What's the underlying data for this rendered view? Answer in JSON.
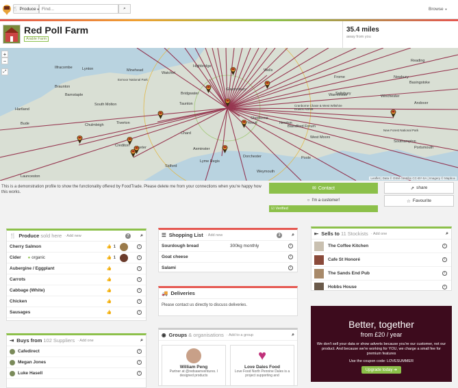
{
  "topbar": {
    "produce_label": "Produce",
    "search_placeholder": "Find...",
    "browse_label": "Browse"
  },
  "header": {
    "title": "Red Poll Farm",
    "badge": "Arable Farm",
    "distance": "35.4 miles",
    "distance_sub": "away from you"
  },
  "map": {
    "places": [
      {
        "name": "Ilfracombe"
      },
      {
        "name": "Lynton"
      },
      {
        "name": "Minehead"
      },
      {
        "name": "Watchet"
      },
      {
        "name": "Bridgwater"
      },
      {
        "name": "Glastonbury"
      },
      {
        "name": "Wells"
      },
      {
        "name": "Frome"
      },
      {
        "name": "Warminster"
      },
      {
        "name": "Basingstoke"
      },
      {
        "name": "Reading"
      },
      {
        "name": "Newbury"
      },
      {
        "name": "Andover"
      },
      {
        "name": "Salisbury"
      },
      {
        "name": "Winchester"
      },
      {
        "name": "Braunton"
      },
      {
        "name": "Barnstaple"
      },
      {
        "name": "South Molton"
      },
      {
        "name": "Taunton"
      },
      {
        "name": "Chard"
      },
      {
        "name": "Yeovil"
      },
      {
        "name": "Sherborne"
      },
      {
        "name": "Blandford Forum"
      },
      {
        "name": "Hartland"
      },
      {
        "name": "Chulmleigh"
      },
      {
        "name": "Tiverton"
      },
      {
        "name": "Crediton"
      },
      {
        "name": "Exeter"
      },
      {
        "name": "Axminster"
      },
      {
        "name": "Dorchester"
      },
      {
        "name": "Weymouth"
      },
      {
        "name": "Poole"
      },
      {
        "name": "Southampton"
      },
      {
        "name": "Portsmouth"
      },
      {
        "name": "Bude"
      },
      {
        "name": "Launceston"
      },
      {
        "name": "Sidford"
      },
      {
        "name": "Lyme Regis"
      },
      {
        "name": "West Moors"
      },
      {
        "name": "Newton"
      },
      {
        "name": "Exmoor National Park"
      },
      {
        "name": "New Forest National Park"
      },
      {
        "name": "Cranborne Chase & West Wiltshire Downs AONB"
      },
      {
        "name": "Highbridge"
      }
    ],
    "attribution": "Leaflet | Data © OSM contribs CC-BY-SA | Imagery © Mapbox"
  },
  "profile": {
    "description": "This is a demonstration profile to show the functionality offered by FoodTrade. Please delete me from your connections when you're happy how this works.",
    "contact": "Contact",
    "customer": "I'm a customer!",
    "verified": "Verified",
    "share": "share",
    "favourite": "Favourite"
  },
  "produce": {
    "title": "Produce",
    "sub": "sold here",
    "add": "· Add new",
    "count": "7",
    "items": [
      {
        "name": "Cherry Salmon",
        "likes": "1",
        "tag": ""
      },
      {
        "name": "Cider",
        "likes": "1",
        "tag": "organic"
      },
      {
        "name": "Aubergine / Eggplant",
        "likes": "",
        "tag": ""
      },
      {
        "name": "Carrots",
        "likes": "",
        "tag": ""
      },
      {
        "name": "Cabbage (White)",
        "likes": "",
        "tag": ""
      },
      {
        "name": "Chicken",
        "likes": "",
        "tag": ""
      },
      {
        "name": "Sausages",
        "likes": "",
        "tag": ""
      }
    ]
  },
  "shopping": {
    "title": "Shopping List",
    "add": "· Add new",
    "count": "3",
    "items": [
      {
        "name": "Sourdough bread",
        "qty": "300kg monthly"
      },
      {
        "name": "Goat cheese",
        "qty": ""
      },
      {
        "name": "Salami",
        "qty": ""
      }
    ]
  },
  "deliveries": {
    "title": "Deliveries",
    "text": "Please contact us directly to discuss deliveries."
  },
  "sells": {
    "title": "Sells to",
    "count": "11",
    "sub": "Stockists",
    "add": "· Add one",
    "items": [
      {
        "name": "The Coffee Kitchen"
      },
      {
        "name": "Cafe St Honoré"
      },
      {
        "name": "The Sands End Pub"
      },
      {
        "name": "Hobbs House"
      }
    ]
  },
  "buys": {
    "title": "Buys from",
    "count": "102",
    "sub": "Suppliers",
    "add": "· Add one",
    "items": [
      {
        "name": "Cafedirect"
      },
      {
        "name": "Megan Jones"
      },
      {
        "name": "Luke Hasell"
      }
    ]
  },
  "groups": {
    "title": "Groups",
    "sub": "& organisations",
    "add": "· Add to a group",
    "items": [
      {
        "name": "William Peng",
        "desc": "Partner at @redsawnventures. I designed products"
      },
      {
        "name": "Love Dales Food",
        "desc": "Love Food North Pennine Dales is a project supporting and"
      }
    ]
  },
  "promo": {
    "title": "Better, together",
    "price": "from £20 / year",
    "body": "We don't sell your data or show adverts because you're our customer, not our product. And because we're working for YOU, we charge a small fee for premium features",
    "coupon": "Use the coupon code: LOVESUMMER",
    "cta": "Upgrade today"
  },
  "colors": {
    "accent": "#8cc04a",
    "route": "#8b1a3a",
    "promo_bg": "#3d0b1d"
  }
}
